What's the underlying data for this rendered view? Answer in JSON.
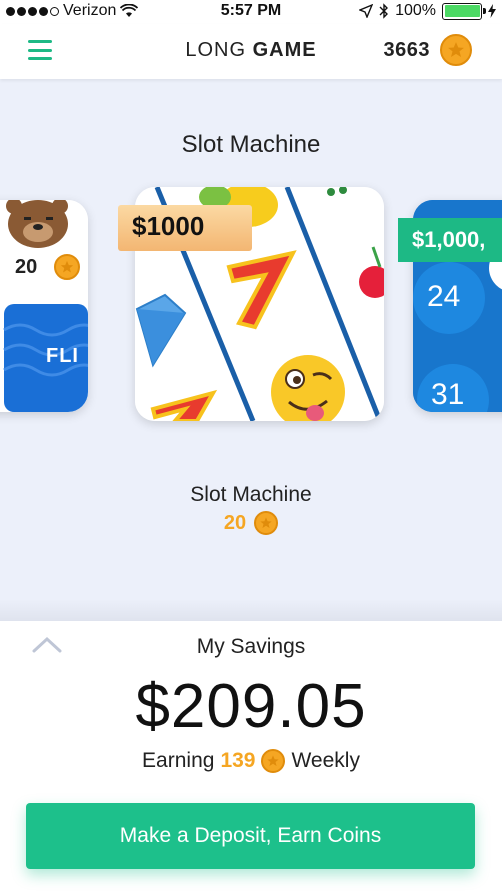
{
  "status_bar": {
    "carrier": "Verizon",
    "time": "5:57 PM",
    "battery": "100%"
  },
  "header": {
    "brand_light": "LONG",
    "brand_bold": "GAME",
    "coin_count": "3663"
  },
  "game": {
    "title": "Slot Machine",
    "cards": [
      {
        "name": "flip-card",
        "cost": "20",
        "label": "FLI"
      },
      {
        "name": "slot-machine",
        "prize": "$1000"
      },
      {
        "name": "bingo-card",
        "prize": "$1,000,",
        "numbers": [
          "24",
          "31"
        ]
      }
    ],
    "selected_name": "Slot Machine",
    "selected_cost": "20"
  },
  "savings": {
    "label": "My Savings",
    "amount": "$209.05",
    "earning_prefix": "Earning",
    "earning_value": "139",
    "earning_suffix": "Weekly",
    "deposit_button": "Make a Deposit, Earn Coins"
  },
  "colors": {
    "accent_green": "#1dc08b",
    "coin_gold": "#f5a623",
    "area_background": "#ecf0fa"
  }
}
